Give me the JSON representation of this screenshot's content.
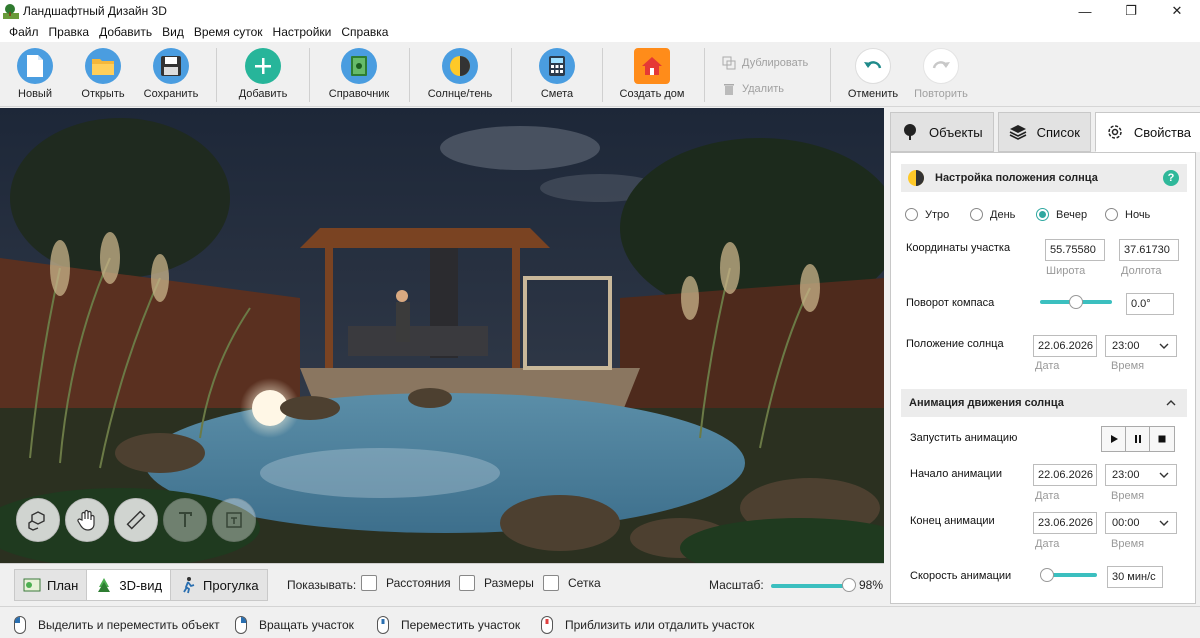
{
  "window": {
    "title": "Ландшафтный Дизайн 3D",
    "minimize": "—",
    "maximize": "❐",
    "close": "✕"
  },
  "menu": [
    "Файл",
    "Правка",
    "Добавить",
    "Вид",
    "Время суток",
    "Настройки",
    "Справка"
  ],
  "toolbar": {
    "new": "Новый",
    "open": "Открыть",
    "save": "Сохранить",
    "add": "Добавить",
    "reference": "Справочник",
    "sun_shadow": "Солнце/тень",
    "estimate": "Смета",
    "create_house": "Создать дом",
    "duplicate": "Дублировать",
    "delete": "Удалить",
    "undo": "Отменить",
    "redo": "Повторить"
  },
  "view_tabs": {
    "plan": "План",
    "view3d": "3D-вид",
    "walk": "Прогулка"
  },
  "show": {
    "label": "Показывать:",
    "distances": "Расстояния",
    "sizes": "Размеры",
    "grid": "Сетка"
  },
  "zoom": {
    "label": "Масштаб:",
    "value": "98%",
    "fraction": 0.98
  },
  "status": {
    "select_move": "Выделить и переместить объект",
    "rotate": "Вращать участок",
    "move": "Переместить участок",
    "zoom": "Приблизить или отдалить участок"
  },
  "panel": {
    "tabs": {
      "objects": "Объекты",
      "list": "Список",
      "properties": "Свойства"
    },
    "sun_section": {
      "title": "Настройка положения солнца",
      "help": "?",
      "radios": {
        "morning": "Утро",
        "day": "День",
        "evening": "Вечер",
        "night": "Ночь"
      },
      "selected": "evening",
      "coords_label": "Координаты участка",
      "latitude": "55.75580",
      "latitude_label": "Широта",
      "longitude": "37.61730",
      "longitude_label": "Долгота",
      "compass_label": "Поворот компаса",
      "compass_value": "0.0°",
      "compass_fraction": 0.5,
      "sun_pos_label": "Положение солнца",
      "sun_date": "22.06.2026",
      "date_label": "Дата",
      "sun_time": "23:00",
      "time_label": "Время"
    },
    "anim_section": {
      "title": "Анимация движения солнца",
      "start_label": "Запустить анимацию",
      "begin_label": "Начало анимации",
      "begin_date": "22.06.2026",
      "begin_time": "23:00",
      "end_label": "Конец анимации",
      "end_date": "23.06.2026",
      "end_time": "00:00",
      "date_label": "Дата",
      "time_label": "Время",
      "speed_label": "Скорость анимации",
      "speed_value": "30 мин/с",
      "speed_fraction": 0.1
    }
  },
  "colors": {
    "accent": "#3bbfbf",
    "help": "#2fb89a"
  }
}
